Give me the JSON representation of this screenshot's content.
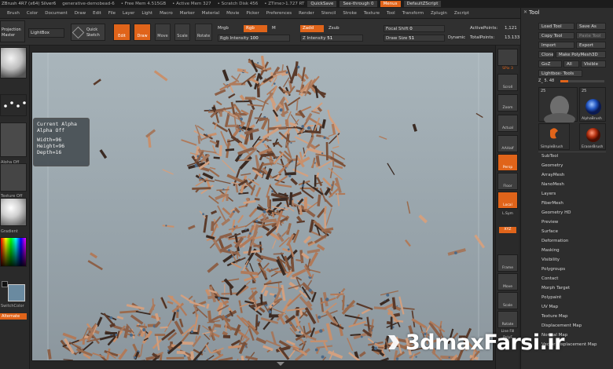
{
  "titlebar": {
    "app": "ZBrush 4R7 (x64) Silver6",
    "doc": "generative-demobead-6",
    "free_mem": "• Free Mem 4.515GB",
    "active_mem": "• Active Mem 327",
    "scratch": "• Scratch Disk 456",
    "ztime": "• ZTime>1.727 RT",
    "quicksave": "QuickSave",
    "see_through": "See-through 0",
    "menus": "Menus",
    "default_script": "DefaultZScript"
  },
  "menubar": [
    "Brush",
    "Color",
    "Document",
    "Draw",
    "Edit",
    "File",
    "Layer",
    "Light",
    "Macro",
    "Marker",
    "Material",
    "Movie",
    "Picker",
    "Preferences",
    "Render",
    "Stencil",
    "Stroke",
    "Texture",
    "Tool",
    "Transform",
    "Zplugin",
    "Zscript"
  ],
  "shelf": {
    "projection": "Projection",
    "master": "Master",
    "lightbox": "LightBox",
    "quick_sketch_1": "Quick",
    "quick_sketch_2": "Sketch",
    "edit": "Edit",
    "draw": "Draw",
    "move": "Move",
    "scale": "Scale",
    "rotate": "Rotate",
    "mrgb": "Mrgb",
    "rgb": "Rgb",
    "m": "M",
    "zadd": "Zadd",
    "zsub": "Zsub",
    "rgb_intensity_label": "Rgb Intensity",
    "rgb_intensity_value": "100",
    "z_intensity_label": "Z Intensity",
    "z_intensity_value": "51",
    "focal_shift_label": "Focal Shift",
    "focal_shift_value": "0",
    "draw_size_label": "Draw Size",
    "draw_size_value": "51",
    "dynamic": "Dynamic",
    "active_points_label": "ActivePoints:",
    "active_points_value": "1,121",
    "total_points_label": "TotalPoints:",
    "total_points_value": "13.133"
  },
  "left_tray": {
    "label_alpha_off": "Alpha Off",
    "label_texture_off": "Texture Off",
    "label_switch_color": "SwitchColor",
    "label_gradient": "Gradient",
    "label_alternate": "Alternate"
  },
  "alpha_popup": {
    "line1": "Current Alpha",
    "line2": "Alpha Off",
    "line3": "Width=96",
    "line4": "Height=96",
    "line5": "Depth=16"
  },
  "right_column": {
    "spix": "SPix 3",
    "scroll": "Scroll",
    "zoom": "Zoom",
    "actual": "Actual",
    "aahalf": "AAHalf",
    "persp": "Persp",
    "floor": "Floor",
    "local": "Local",
    "lsym": "L.Sym",
    "xyz": "XYZ",
    "frame": "Frame",
    "move": "Move",
    "scale": "Scale",
    "rotate": "Rotate",
    "linefill": "Line Fill",
    "polyf": "PolyF"
  },
  "tool_palette": {
    "title": "Tool",
    "load_tool": "Load Tool",
    "save_as": "Save As",
    "copy_tool": "Copy Tool",
    "paste_tool": "Paste Tool",
    "import": "Import",
    "export": "Export",
    "clone": "Clone",
    "make_polymesh": "Make PolyMesh3D",
    "goz": "GoZ",
    "all": "All",
    "visible": "Visible",
    "lightbox_tools": "Lightbox› Tools",
    "current_tool": "Z_ 5. 48",
    "thumb_count_1": "25",
    "thumb_count_2": "25",
    "simple_brush": "SimpleBrush",
    "alpha_brush": "AlphaBrush",
    "eraser_brush": "EraserBrush",
    "subpalettes": [
      "SubTool",
      "Geometry",
      "ArrayMesh",
      "NanoMesh",
      "Layers",
      "FiberMesh",
      "Geometry HD",
      "Preview",
      "Surface",
      "Deformation",
      "Masking",
      "Visibility",
      "Polygroups",
      "Contact",
      "Morph Target",
      "Polypaint",
      "UV Map",
      "Texture Map",
      "Displacement Map",
      "Normal Map",
      "Vector Displacement Map"
    ]
  },
  "watermark": {
    "text": "3dmaxFarsi.ir"
  },
  "colors": {
    "accent": "#e0641a",
    "panel": "#2d2d2d",
    "viewport": "#a0acb2"
  }
}
